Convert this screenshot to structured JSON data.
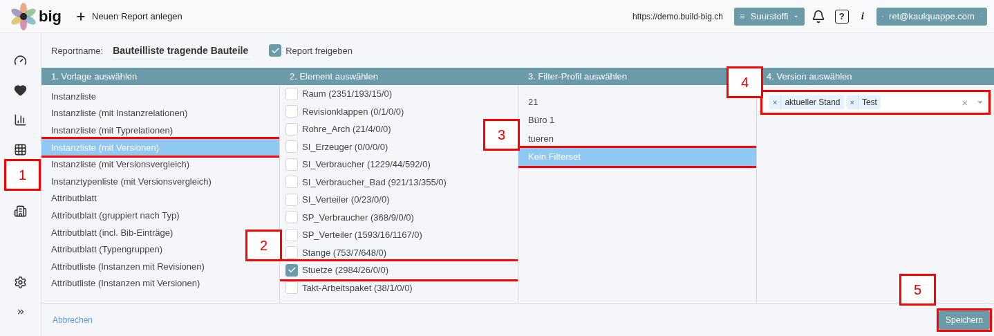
{
  "header": {
    "logo_text": "big",
    "new_report": "Neuen Report anlegen",
    "url": "https://demo.build-big.ch",
    "project": "Suurstoffi",
    "help": "?",
    "info": "i",
    "user": "ret@kaulquappe.com"
  },
  "report": {
    "name_label": "Reportname:",
    "name_value": "Bauteilliste tragende Bauteile",
    "release_label": "Report freigeben",
    "release_checked": true
  },
  "columns": [
    {
      "title": "1. Vorlage auswählen"
    },
    {
      "title": "2. Element auswählen"
    },
    {
      "title": "3. Filter-Profil auswählen"
    },
    {
      "title": "4. Version auswählen"
    }
  ],
  "templates": [
    {
      "label": "Instanzliste",
      "selected": false
    },
    {
      "label": "Instanzliste (mit Instanzrelationen)",
      "selected": false
    },
    {
      "label": "Instanzliste (mit Typrelationen)",
      "selected": false
    },
    {
      "label": "Instanzliste (mit Versionen)",
      "selected": true
    },
    {
      "label": "Instanzliste (mit Versionsvergleich)",
      "selected": false
    },
    {
      "label": "Instanztypenliste (mit Versionsvergleich)",
      "selected": false
    },
    {
      "label": "Attributblatt",
      "selected": false
    },
    {
      "label": "Attributblatt (gruppiert nach Typ)",
      "selected": false
    },
    {
      "label": "Attributblatt (incl. Bib-Einträge)",
      "selected": false
    },
    {
      "label": "Attributblatt (Typengruppen)",
      "selected": false
    },
    {
      "label": "Attributliste (Instanzen mit Revisionen)",
      "selected": false
    },
    {
      "label": "Attributliste (Instanzen mit Versionen)",
      "selected": false
    }
  ],
  "elements": [
    {
      "label": "Raum (2351/193/15/0)",
      "checked": false
    },
    {
      "label": "Revisionklappen (0/1/0/0)",
      "checked": false
    },
    {
      "label": "Rohre_Arch (21/4/0/0)",
      "checked": false
    },
    {
      "label": "SI_Erzeuger (0/0/0/0)",
      "checked": false
    },
    {
      "label": "SI_Verbraucher (1229/44/592/0)",
      "checked": false
    },
    {
      "label": "SI_Verbraucher_Bad (921/13/355/0)",
      "checked": false
    },
    {
      "label": "SI_Verteiler (0/23/0/0)",
      "checked": false
    },
    {
      "label": "SP_Verbraucher (368/9/0/0)",
      "checked": false
    },
    {
      "label": "SP_Verteiler (1593/16/1167/0)",
      "checked": false
    },
    {
      "label": "Stange (753/7/648/0)",
      "checked": false
    },
    {
      "label": "Stuetze (2984/26/0/0)",
      "checked": true
    },
    {
      "label": "Takt-Arbeitspaket (38/1/0/0)",
      "checked": false
    }
  ],
  "filter_profiles": [
    {
      "label": "21",
      "selected": false
    },
    {
      "label": "Büro 1",
      "selected": false
    },
    {
      "label": "tueren",
      "selected": false
    },
    {
      "label": "Kein Filterset",
      "selected": true
    }
  ],
  "versions": {
    "tags": [
      {
        "label": "aktueller Stand",
        "remove": "×"
      },
      {
        "label": "Test",
        "remove": "×"
      }
    ],
    "clear": "×"
  },
  "footer": {
    "cancel": "Abbrechen",
    "save": "Speichern"
  },
  "annotations": [
    {
      "label": "1"
    },
    {
      "label": "2"
    },
    {
      "label": "3"
    },
    {
      "label": "4"
    },
    {
      "label": "5"
    }
  ]
}
